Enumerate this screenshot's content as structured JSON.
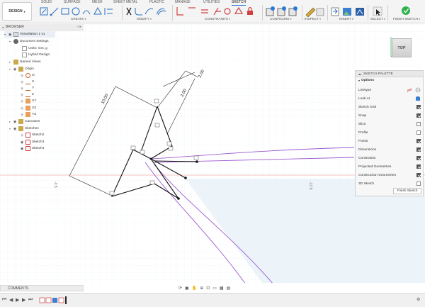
{
  "toolbar": {
    "workspace_label": "DESIGN",
    "tabs": [
      "SOLID",
      "SURFACE",
      "MESH",
      "SHEET METAL",
      "PLASTIC",
      "MANAGE",
      "UTILITIES",
      "SKETCH"
    ],
    "groups": {
      "create": "CREATE",
      "modify": "MODIFY",
      "constraints": "CONSTRAINTS",
      "configure": "CONFIGURE",
      "inspect": "INSPECT",
      "insert": "INSERT",
      "select": "SELECT",
      "finish": "FINISH SKETCH"
    },
    "accent": "#2a7ad5",
    "finish_color": "#2fb24a"
  },
  "browser": {
    "title": "BROWSER",
    "root": "Tessellation 1 v1",
    "items": [
      {
        "label": "Document Settings"
      },
      {
        "label": "Units: mm, g"
      },
      {
        "label": "Hybrid Design"
      },
      {
        "label": "Named Views"
      },
      {
        "label": "Origin"
      },
      {
        "label": "O"
      },
      {
        "label": "X"
      },
      {
        "label": "Y"
      },
      {
        "label": "Z"
      },
      {
        "label": "XY"
      },
      {
        "label": "XZ"
      },
      {
        "label": "YZ"
      },
      {
        "label": "Canvases"
      },
      {
        "label": "Sketches"
      },
      {
        "label": "Sketch2"
      },
      {
        "label": "Sketch3"
      },
      {
        "label": "Sketch4"
      }
    ]
  },
  "viewcube": {
    "label": "TOP"
  },
  "sketch": {
    "dims": [
      "10.00",
      "2.00",
      "2.00"
    ],
    "axis_labels": [
      "-0.5",
      "-17.5"
    ],
    "line_color": "#1a1a1a",
    "projected_color": "#9b59d0",
    "axis_color": "#e07070"
  },
  "palette": {
    "title": "SKETCH PALETTE",
    "section": "Options",
    "options": [
      {
        "label": "Linetype",
        "type": "icon"
      },
      {
        "label": "Look At",
        "type": "icon"
      },
      {
        "label": "Sketch Grid",
        "checked": true
      },
      {
        "label": "Snap",
        "checked": true
      },
      {
        "label": "Slice",
        "checked": false
      },
      {
        "label": "Profile",
        "checked": false
      },
      {
        "label": "Points",
        "checked": true
      },
      {
        "label": "Dimensions",
        "checked": true
      },
      {
        "label": "Constraints",
        "checked": true
      },
      {
        "label": "Projected Geometries",
        "checked": true
      },
      {
        "label": "Construction Geometries",
        "checked": true
      },
      {
        "label": "3D Sketch",
        "checked": false
      }
    ],
    "finish_label": "Finish Sketch"
  },
  "comments": {
    "label": "COMMENTS"
  }
}
